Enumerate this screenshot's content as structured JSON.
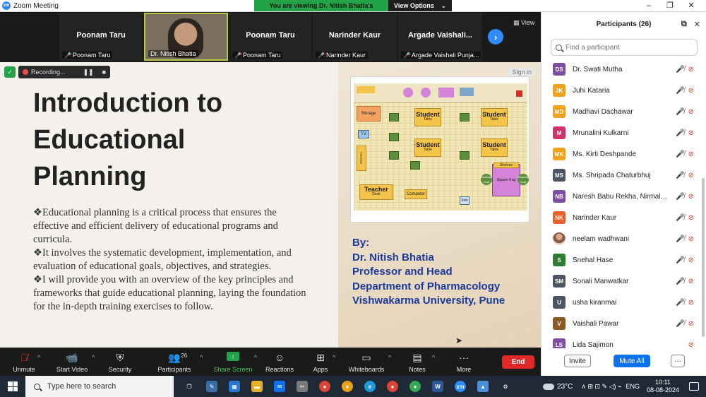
{
  "window": {
    "app_title": "Zoom Meeting",
    "share_banner": "You are viewing Dr. Nitish Bhatia's screen",
    "view_options": "View Options",
    "view_options_caret": "⌄",
    "logo_text": "zm",
    "minimize": "–",
    "maximize": "❐",
    "close": "✕"
  },
  "thumbnails": [
    {
      "name": "Poonam Taru",
      "label": "Poonam Taru",
      "muted": true,
      "video": false
    },
    {
      "name": "",
      "label": "Dr. Nitish Bhatia",
      "muted": false,
      "video": true
    },
    {
      "name": "Poonam Taru",
      "label": "Poonam Taru",
      "muted": true,
      "video": false
    },
    {
      "name": "Narinder Kaur",
      "label": "Narinder Kaur",
      "muted": true,
      "video": false
    },
    {
      "name": "Argade  Vaishali...",
      "label": "Argade Vaishali Punja...",
      "muted": true,
      "video": false
    }
  ],
  "strip": {
    "next": "›",
    "view_label": "View",
    "view_icon": "▦"
  },
  "recording": {
    "label": "Recording...",
    "pause": "❚❚",
    "stop": "■",
    "shield": "✓"
  },
  "slide": {
    "title_lines": [
      "Introduction to",
      "Educational",
      "Planning"
    ],
    "bullets": [
      "❖Educational planning is a critical process that ensures the effective and efficient delivery of educational programs and curricula.",
      "❖It involves the systematic development, implementation, and evaluation of educational goals, objectives, and strategies.",
      "❖I will provide you with an overview of the key principles and frameworks that guide educational planning, laying the foundation for the in-depth training exercises to follow."
    ],
    "sign_in": "Sign in",
    "byline": [
      "By:",
      "Dr. Nitish Bhatia",
      "Professor and Head",
      "Department of Pharmacology",
      "Vishwakarma University, Pune"
    ],
    "floorplan": {
      "storage": "Storage",
      "tv": "TV",
      "computer_side": "Computer",
      "student": "Student",
      "table": "Table",
      "teacher": "Teacher",
      "desk": "Desk",
      "computer": "Computer",
      "shelves": "Shelves",
      "beanbag": "Beanbag Chair",
      "square_rug": "Square Rug",
      "sink": "Sink"
    }
  },
  "participants": {
    "header": "Participants (26)",
    "popout_icon": "⧉",
    "close_icon": "✕",
    "search_placeholder": "Find a participant",
    "mic_icon": "🎤̸",
    "cam_icon": "⊘",
    "list": [
      {
        "initials": "DS",
        "name": "Dr. Swati Mutha",
        "color": "#7c4fa0",
        "photo": false,
        "show_mic": true
      },
      {
        "initials": "JK",
        "name": "Juhi Kataria",
        "color": "#f0a21c",
        "photo": false,
        "show_mic": true
      },
      {
        "initials": "MD",
        "name": "Madhavi Dachawar",
        "color": "#f0a21c",
        "photo": false,
        "show_mic": true
      },
      {
        "initials": "M",
        "name": "Mrunalini Kulkarni",
        "color": "#d0336c",
        "photo": false,
        "show_mic": true
      },
      {
        "initials": "MK",
        "name": "Ms. Kirti Deshpande",
        "color": "#f0a21c",
        "photo": false,
        "show_mic": true
      },
      {
        "initials": "MS",
        "name": "Ms. Shripada Chaturbhuj",
        "color": "#4b5563",
        "photo": false,
        "show_mic": true
      },
      {
        "initials": "NB",
        "name": "Naresh Babu Rekha, Nirmala C...",
        "color": "#7c4fa0",
        "photo": false,
        "show_mic": true
      },
      {
        "initials": "NK",
        "name": "Narinder Kaur",
        "color": "#e8602c",
        "photo": false,
        "show_mic": true
      },
      {
        "initials": "",
        "name": "neelam wadhwani",
        "color": "#c9a080",
        "photo": true,
        "show_mic": true
      },
      {
        "initials": "S",
        "name": "Snehal Hase",
        "color": "#2e7d32",
        "photo": false,
        "show_mic": true
      },
      {
        "initials": "SM",
        "name": "Sonali Manwatkar",
        "color": "#4b5563",
        "photo": false,
        "show_mic": true
      },
      {
        "initials": "U",
        "name": "usha kiranmai",
        "color": "#4b5563",
        "photo": false,
        "show_mic": true
      },
      {
        "initials": "V",
        "name": "Vaishali Pawar",
        "color": "#8a5a20",
        "photo": false,
        "show_mic": true
      },
      {
        "initials": "LS",
        "name": "Lida Sajimon",
        "color": "#7c4fa0",
        "photo": false,
        "show_mic": false
      }
    ],
    "invite": "Invite",
    "mute_all": "Mute All",
    "more": "···"
  },
  "toolbar": {
    "unmute": "Unmute",
    "start_video": "Start Video",
    "security": "Security",
    "participants": "Participants",
    "participants_count": "26",
    "share_screen": "Share Screen",
    "reactions": "Reactions",
    "apps": "Apps",
    "whiteboards": "Whiteboards",
    "notes": "Notes",
    "more": "More",
    "end": "End",
    "caret": "^",
    "icons": {
      "unmute": "🎙̸",
      "video": "📹",
      "security": "⛨",
      "participants": "👥",
      "share": "↑",
      "reactions": "☺",
      "apps": "⊞",
      "whiteboards": "▭",
      "notes": "▤",
      "more": "···"
    }
  },
  "taskbar": {
    "search_placeholder": "Type here to search",
    "temperature": "23°C",
    "language": "ENG",
    "time": "10:11",
    "date": "08-08-2024",
    "tray_glyphs": "∧ ⊞ ⊡ ✎ ◁) ⌁",
    "apps": [
      {
        "name": "task-view",
        "glyph": "❐",
        "color": "#1f2a36"
      },
      {
        "name": "notes-app",
        "glyph": "✎",
        "color": "#3b6ea5"
      },
      {
        "name": "store",
        "glyph": "▦",
        "color": "#2b78d4"
      },
      {
        "name": "file-explorer",
        "glyph": "▬",
        "color": "#e6b12a"
      },
      {
        "name": "mail",
        "glyph": "✉",
        "color": "#0e72ed"
      },
      {
        "name": "tools",
        "glyph": "✂",
        "color": "#7a7a7a"
      },
      {
        "name": "chrome",
        "glyph": "●",
        "color": "#db4437",
        "round": true
      },
      {
        "name": "chrome-alt",
        "glyph": "●",
        "color": "#e8a21c",
        "round": true
      },
      {
        "name": "edge",
        "glyph": "e",
        "color": "#1a9be0",
        "round": true
      },
      {
        "name": "chrome-2",
        "glyph": "●",
        "color": "#db4437",
        "round": true
      },
      {
        "name": "chrome-3",
        "glyph": "●",
        "color": "#34a853",
        "round": true
      },
      {
        "name": "word",
        "glyph": "W",
        "color": "#2b5797"
      },
      {
        "name": "zoom",
        "glyph": "zm",
        "color": "#2d8cff",
        "round": true
      },
      {
        "name": "photos",
        "glyph": "▲",
        "color": "#4a90d9"
      },
      {
        "name": "settings",
        "glyph": "⚙",
        "color": "#1f2a36"
      }
    ]
  }
}
